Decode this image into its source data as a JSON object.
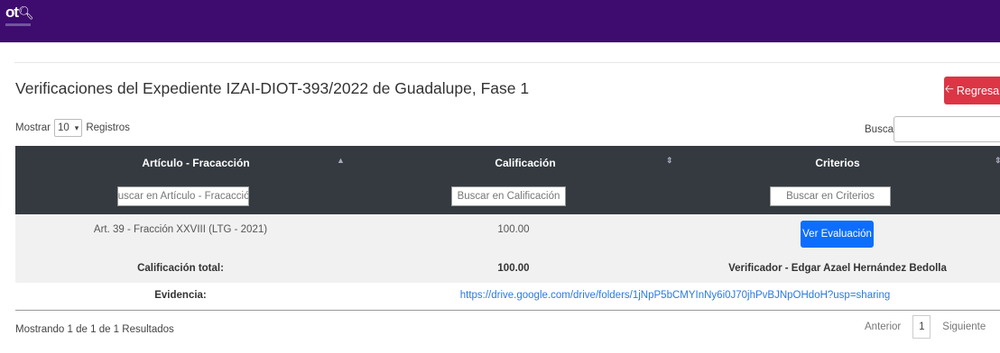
{
  "header": {
    "logo_text": "ot",
    "logo_glyph": "🔍︎"
  },
  "page": {
    "title": "Verificaciones del Expediente IZAI-DIOT-393/2022 de Guadalupe, Fase 1"
  },
  "back_button": {
    "icon": "arrow-left-icon",
    "label": "Regresar",
    "color": "#dc3545"
  },
  "length_menu": {
    "prefix": "Mostrar",
    "value": "10",
    "suffix": "Registros"
  },
  "search": {
    "label": "Buscar:",
    "value": ""
  },
  "table": {
    "columns": [
      {
        "label": "Artículo - Fracacción",
        "sort": "▲"
      },
      {
        "label": "Calificación",
        "sort": "⇕"
      },
      {
        "label": "Criterios",
        "sort": "⇕"
      }
    ],
    "filters": [
      {
        "placeholder": "Buscar en Artículo - Fracacción"
      },
      {
        "placeholder": "Buscar en Calificación"
      },
      {
        "placeholder": "Buscar en Criterios"
      }
    ],
    "rows": [
      {
        "articulo": "Art. 39 - Fracción XXVIII (LTG - 2021)",
        "calificacion": "100.00",
        "action_label": "Ver Evaluación"
      }
    ],
    "total_row": {
      "label": "Calificación total:",
      "value": "100.00",
      "verifier": "Verificador - Edgar Azael Hernández Bedolla"
    },
    "evidence_row": {
      "label": "Evidencia:",
      "link": "https://drive.google.com/drive/folders/1jNpP5bCMYInNy6i0J70jhPvBJNpOHdoH?usp=sharing"
    }
  },
  "footer": {
    "info": "Mostrando 1 de 1 de 1 Resultados",
    "prev_label": "Anterior",
    "current_page": "1",
    "next_label": "Siguiente"
  },
  "colors": {
    "topbar": "#3d0c6e",
    "table_header": "#343a40",
    "primary": "#0d6efd"
  }
}
